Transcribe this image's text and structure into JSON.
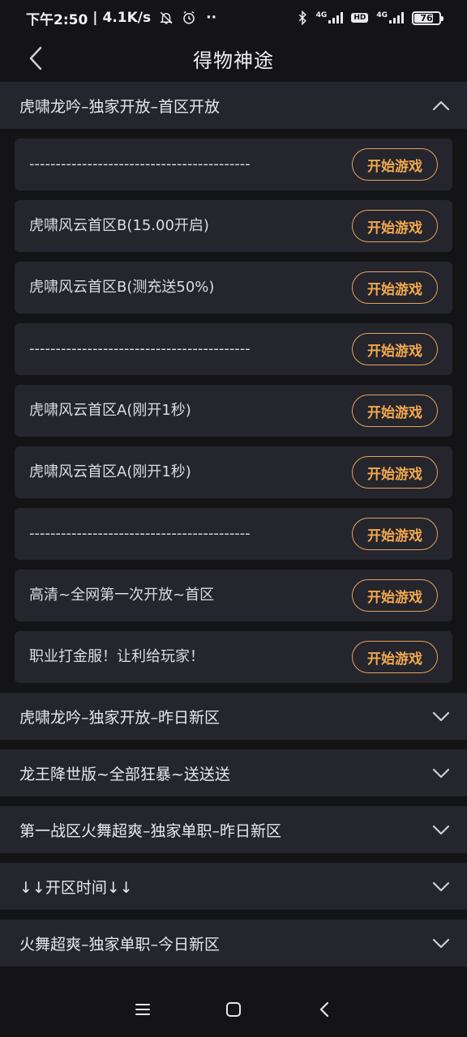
{
  "status": {
    "time": "下午2:50",
    "speed": "4.1K/s",
    "network_tag_1": "4G",
    "hd": "HD",
    "network_tag_2": "4G",
    "battery_level": 76,
    "battery": "76",
    "icons": [
      "mute-bell-icon",
      "alarm-icon",
      "more-dots-icon",
      "bluetooth-icon",
      "signal-icon",
      "battery-icon"
    ]
  },
  "header": {
    "title": "得物神途",
    "back_icon": "chevron-left-icon"
  },
  "expanded_group": {
    "title": "虎啸龙吟–独家开放–首区开放",
    "play_label": "开始游戏",
    "items": [
      "------------------------------------------",
      "虎啸风云首区B(15.00开启)",
      "虎啸风云首区B(测充送50%)",
      "------------------------------------------",
      "虎啸风云首区A(刚开1秒)",
      "虎啸风云首区A(刚开1秒)",
      "------------------------------------------",
      "高清~全网第一次开放~首区",
      "职业打金服！让利给玩家！"
    ]
  },
  "collapsed_groups": [
    "虎啸龙吟–独家开放–昨日新区",
    "龙王降世版~全部狂暴~送送送",
    "第一战区火舞超爽–独家单职–昨日新区",
    "↓↓开区时间↓↓",
    "火舞超爽–独家单职–今日新区"
  ],
  "nav": {
    "icons": [
      "menu-icon",
      "home-icon",
      "back-icon"
    ]
  },
  "colors": {
    "background": "#141416",
    "card": "#24252d",
    "accent": "#f2a94e"
  }
}
